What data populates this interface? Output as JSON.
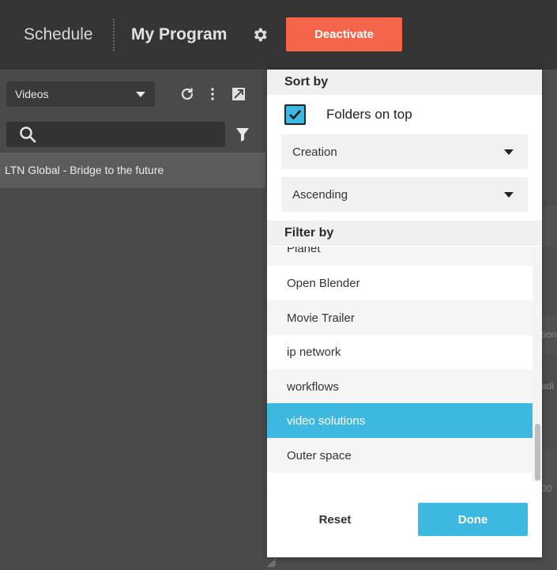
{
  "topbar": {
    "schedule_label": "Schedule",
    "program_title": "My Program",
    "deactivate_label": "Deactivate"
  },
  "left_panel": {
    "source_select": {
      "selected": "Videos"
    },
    "search": {
      "placeholder": ""
    },
    "items": [
      {
        "label": "LTN Global - Bridge to the future"
      }
    ]
  },
  "background_fragments": [
    "tion",
    "adi",
    "30"
  ],
  "popup": {
    "sort_by_heading": "Sort by",
    "folders_on_top": {
      "label": "Folders on top",
      "checked": true
    },
    "sort_field": {
      "selected": "Creation"
    },
    "sort_order": {
      "selected": "Ascending"
    },
    "filter_by_heading": "Filter by",
    "filters": [
      {
        "label": "Planet",
        "selected": false
      },
      {
        "label": "Open Blender",
        "selected": false
      },
      {
        "label": "Movie Trailer",
        "selected": false
      },
      {
        "label": "ip network",
        "selected": false
      },
      {
        "label": "workflows",
        "selected": false
      },
      {
        "label": "video solutions",
        "selected": true
      },
      {
        "label": "Outer space",
        "selected": false
      }
    ],
    "reset_label": "Reset",
    "done_label": "Done"
  },
  "colors": {
    "accent": "#3db8e0",
    "deactivate": "#f4654a",
    "topbar_bg": "#353535",
    "panel_bg": "#4a4a4a"
  },
  "icons": [
    "gear-icon",
    "refresh-icon",
    "more-vertical-icon",
    "expand-icon",
    "search-icon",
    "filter-icon",
    "checkmark-icon",
    "chevron-down-icon",
    "resize-handle-icon"
  ]
}
